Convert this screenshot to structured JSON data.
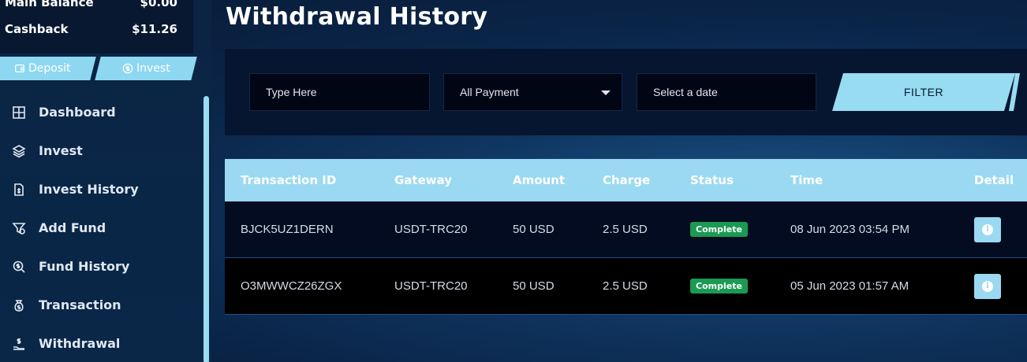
{
  "balances": {
    "main_label": "Main Balance",
    "main_value": "$0.00",
    "cashback_label": "Cashback",
    "cashback_value": "$11.26"
  },
  "quick_actions": {
    "deposit_label": "Deposit",
    "invest_label": "Invest"
  },
  "sidebar": {
    "items": [
      {
        "label": "Dashboard",
        "icon": "grid-icon"
      },
      {
        "label": "Invest",
        "icon": "layers-icon"
      },
      {
        "label": "Invest History",
        "icon": "document-icon"
      },
      {
        "label": "Add Fund",
        "icon": "add-fund-icon"
      },
      {
        "label": "Fund History",
        "icon": "search-dollar-icon"
      },
      {
        "label": "Transaction",
        "icon": "money-bag-icon"
      },
      {
        "label": "Withdrawal",
        "icon": "hand-money-icon"
      }
    ]
  },
  "page": {
    "title": "Withdrawal History"
  },
  "filters": {
    "search_placeholder": "Type Here",
    "payment_selected": "All Payment",
    "date_placeholder": "Select a date",
    "filter_label": "FILTER"
  },
  "table": {
    "headers": [
      "Transaction ID",
      "Gateway",
      "Amount",
      "Charge",
      "Status",
      "Time",
      "Detail"
    ],
    "rows": [
      {
        "id": "BJCK5UZ1DERN",
        "gateway": "USDT-TRC20",
        "amount": "50 USD",
        "charge": "2.5 USD",
        "status": "Complete",
        "time": "08 Jun 2023 03:54 PM"
      },
      {
        "id": "O3MWWCZ26ZGX",
        "gateway": "USDT-TRC20",
        "amount": "50 USD",
        "charge": "2.5 USD",
        "status": "Complete",
        "time": "05 Jun 2023 01:57 AM"
      }
    ]
  },
  "colors": {
    "accent": "#9ad9f1",
    "status_complete": "#1a9a52"
  }
}
